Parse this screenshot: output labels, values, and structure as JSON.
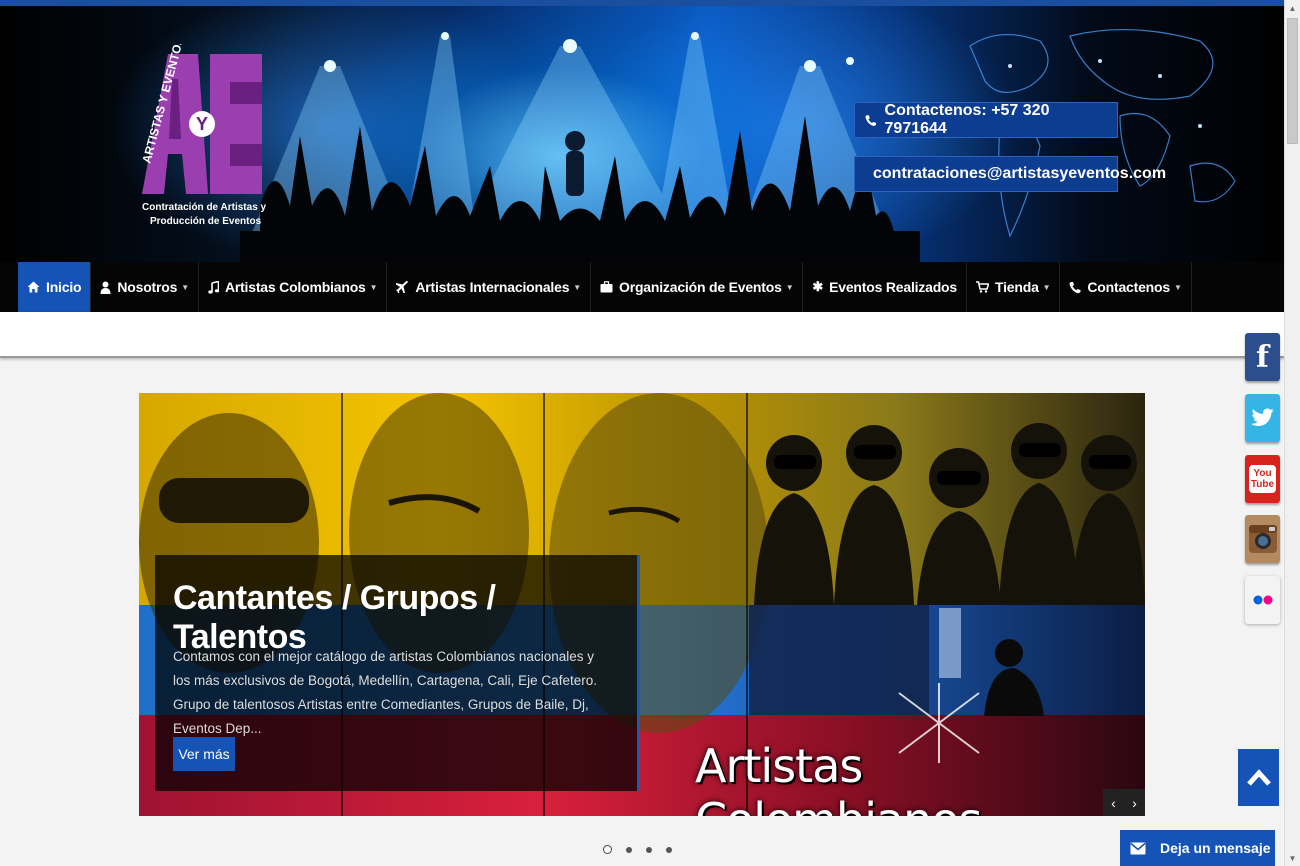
{
  "header": {
    "logo_text": "ARTISTAS Y EVENTOS",
    "logo_tagline_1": "Contratación de Artistas y",
    "logo_tagline_2": "Producción de Eventos",
    "phone": "Contactenos: +57 320 7971644",
    "email": "contrataciones@artistasyeventos.com"
  },
  "nav": {
    "items": [
      {
        "label": "Inicio",
        "icon": "home-icon",
        "active": true
      },
      {
        "label": "Nosotros",
        "icon": "user-icon",
        "caret": true
      },
      {
        "label": "Artistas Colombianos",
        "icon": "music-icon",
        "caret": true
      },
      {
        "label": "Artistas Internacionales",
        "icon": "plane-icon",
        "caret": true
      },
      {
        "label": "Organización de Eventos",
        "icon": "briefcase-icon",
        "caret": true
      },
      {
        "label": "Eventos Realizados",
        "icon": "asterisk-icon",
        "caret": false
      },
      {
        "label": "Tienda",
        "icon": "cart-icon",
        "caret": true
      },
      {
        "label": "Contactenos",
        "icon": "phone-icon",
        "caret": true
      }
    ]
  },
  "slider": {
    "caption_title": "Cantantes / Grupos / Talentos",
    "caption_text": "Contamos con el mejor catálogo de artistas Colombianos nacionales y los más exclusivos de Bogotá, Medellín, Cartagena, Cali, Eje Cafetero. Grupo de talentosos Artistas entre Comediantes, Grupos de Baile, Dj, Eventos Dep...",
    "button_label": "Ver más",
    "image_title": "Artistas Colombianos",
    "prev": "‹",
    "next": "›",
    "slide_count": 4,
    "active_slide": 1
  },
  "social": {
    "facebook": "f",
    "youtube_1": "You",
    "youtube_2": "Tube"
  },
  "chat": {
    "label": "Deja un mensaje"
  },
  "colors": {
    "brand_blue": "#1553b7",
    "nav_bg": "#050505"
  }
}
